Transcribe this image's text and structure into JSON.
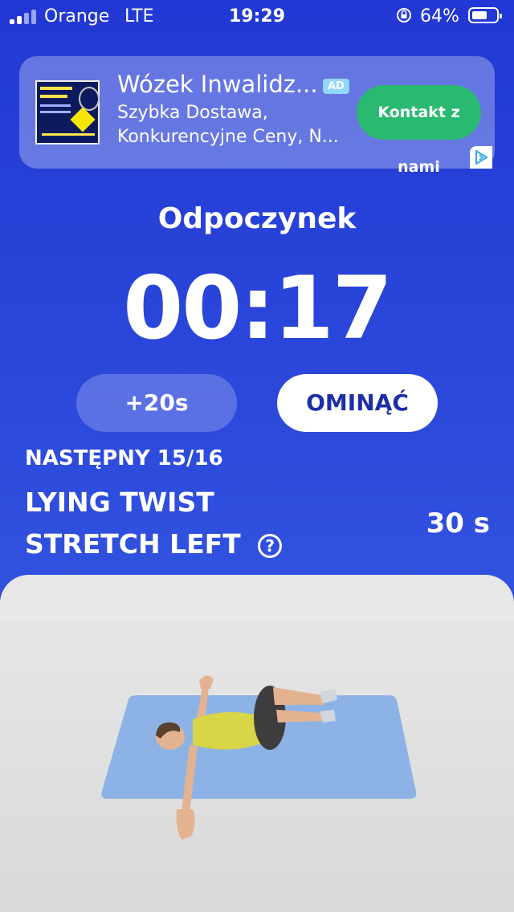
{
  "status_bar": {
    "carrier": "Orange",
    "network": "LTE",
    "time": "19:29",
    "battery": "64%",
    "battery_level": 0.64
  },
  "ad": {
    "title": "Wózek Inwalidz...",
    "badge": "AD",
    "description_line1": "Szybka Dostawa,",
    "description_line2": "Konkurencyjne Ceny, N...",
    "cta": "Kontakt z nami"
  },
  "rest": {
    "label": "Odpoczynek",
    "timer": "00:17"
  },
  "buttons": {
    "add_time": "+20s",
    "skip": "OMINĄĆ"
  },
  "next": {
    "label": "NASTĘPNY 15/16",
    "exercise_line1": "LYING TWIST",
    "exercise_line2": "STRETCH LEFT",
    "help_icon_glyph": "?",
    "duration": "30 s"
  },
  "colors": {
    "background": "#2b45d6",
    "accent_green": "#2ab970",
    "skip_text": "#1c2ea8",
    "mat": "#8db3e6"
  },
  "icons": [
    "signal-icon",
    "rotation-lock-icon",
    "battery-icon",
    "ad-choices-icon",
    "help-icon"
  ]
}
